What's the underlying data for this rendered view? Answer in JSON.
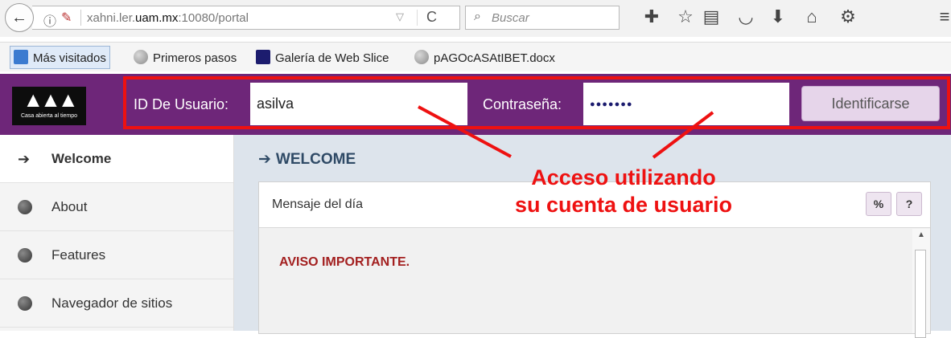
{
  "browser": {
    "url_prefix": "xahni.ler.",
    "url_domain": "uam.mx",
    "url_suffix": ":10080/portal",
    "search_placeholder": "Buscar"
  },
  "bookmarks": [
    {
      "label": "Más visitados"
    },
    {
      "label": "Primeros pasos"
    },
    {
      "label": "Galería de Web Slice"
    },
    {
      "label": "pAGOcASAtIBET.docx"
    }
  ],
  "header": {
    "logo_text": "Casa abierta al tiempo",
    "user_label": "ID De Usuario:",
    "user_value": "asilva",
    "password_label": "Contraseña:",
    "password_mask": "●●●●●●●",
    "login_button": "Identificarse",
    "accent_color": "#6e2679"
  },
  "sidebar": {
    "items": [
      {
        "label": "Welcome",
        "icon": "sign-in-icon",
        "active": true
      },
      {
        "label": "About",
        "icon": "globe-icon"
      },
      {
        "label": "Features",
        "icon": "globe-icon"
      },
      {
        "label": "Navegador de sitios",
        "icon": "globe-icon"
      }
    ]
  },
  "main": {
    "title": "WELCOME",
    "panel_title": "Mensaje del día",
    "link_button": "%",
    "help_button": "?",
    "notice": "AVISO IMPORTANTE."
  },
  "annotation": {
    "line1": "Acceso utilizando",
    "line2": "su cuenta de usuario",
    "color": "#ee1111"
  }
}
